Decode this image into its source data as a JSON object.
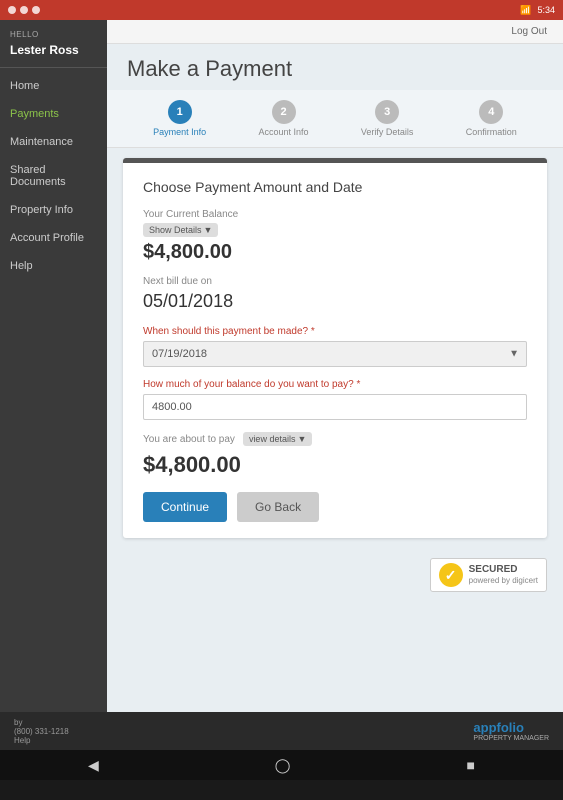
{
  "statusBar": {
    "time": "5:34",
    "icons": [
      "wifi",
      "signal",
      "battery"
    ]
  },
  "sidebar": {
    "hello": "HELLO",
    "username": "Lester Ross",
    "items": [
      {
        "label": "Home",
        "active": false
      },
      {
        "label": "Payments",
        "active": true
      },
      {
        "label": "Maintenance",
        "active": false
      },
      {
        "label": "Shared Documents",
        "active": false
      },
      {
        "label": "Property Info",
        "active": false
      },
      {
        "label": "Account Profile",
        "active": false
      },
      {
        "label": "Help",
        "active": false
      }
    ]
  },
  "header": {
    "logout": "Log Out",
    "pageTitle": "Make a Payment"
  },
  "steps": [
    {
      "number": "1",
      "label": "Payment Info",
      "active": true
    },
    {
      "number": "2",
      "label": "Account Info",
      "active": false
    },
    {
      "number": "3",
      "label": "Verify Details",
      "active": false
    },
    {
      "number": "4",
      "label": "Confirmation",
      "active": false
    }
  ],
  "form": {
    "sectionTitle": "Choose Payment Amount and Date",
    "currentBalanceLabel": "Your Current Balance",
    "showDetailsLabel": "Show Details",
    "currentBalanceAmount": "$4,800.00",
    "nextBillLabel": "Next bill due on",
    "nextBillDate": "05/01/2018",
    "paymentDateLabel": "When should this payment be made?",
    "paymentDateRequired": "*",
    "paymentDateValue": "07/19/2018",
    "amountLabel": "How much of your balance do you want to pay?",
    "amountRequired": "*",
    "amountValue": "4800.00",
    "aboutToPayLabel": "You are about to pay",
    "viewDetailsLabel": "view details",
    "payAmount": "$4,800.00",
    "continueBtn": "Continue",
    "goBackBtn": "Go Back"
  },
  "norton": {
    "securedText": "SECURED",
    "poweredBy": "powered by digicert"
  },
  "footer": {
    "by": "by",
    "phone": "(800) 331-1218",
    "help": "Help",
    "logoText": "appfolio",
    "logoSub": "PROPERTY MANAGER"
  }
}
